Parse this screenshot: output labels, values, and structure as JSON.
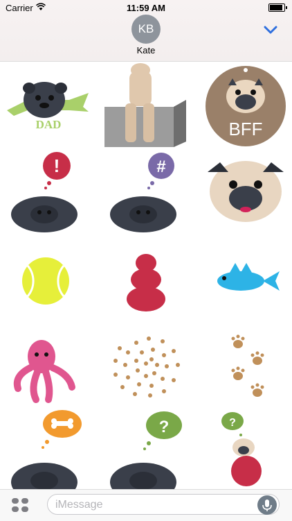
{
  "status": {
    "carrier": "Carrier",
    "time": "11:59 AM",
    "battery": "battery-full"
  },
  "conversation": {
    "avatar_initials": "KB",
    "contact_name": "Kate",
    "collapse_icon": "chevron-down-icon"
  },
  "stickers": [
    {
      "name": "pug-dad-banner",
      "text": "DAD"
    },
    {
      "name": "pug-climbing-block"
    },
    {
      "name": "pug-bff-tag",
      "text": "BFF"
    },
    {
      "name": "pug-exclaim-thought",
      "text": "!"
    },
    {
      "name": "pug-hash-thought",
      "text": "#"
    },
    {
      "name": "pug-face"
    },
    {
      "name": "tennis-ball"
    },
    {
      "name": "red-chew-toy"
    },
    {
      "name": "blue-fish"
    },
    {
      "name": "pink-octopus"
    },
    {
      "name": "paw-spiral"
    },
    {
      "name": "paw-prints"
    },
    {
      "name": "pug-bone-thought"
    },
    {
      "name": "pug-question-thought",
      "text": "?"
    },
    {
      "name": "pug-red-sweater-question",
      "text": "?"
    }
  ],
  "input_bar": {
    "placeholder": "iMessage",
    "apps_icon": "app-drawer-icon",
    "mic_icon": "microphone-icon"
  },
  "colors": {
    "accent": "#2f6fde",
    "pug_black": "#3a3f4a",
    "pug_fawn": "#e8d6c1",
    "tag_brown": "#9a8069"
  }
}
